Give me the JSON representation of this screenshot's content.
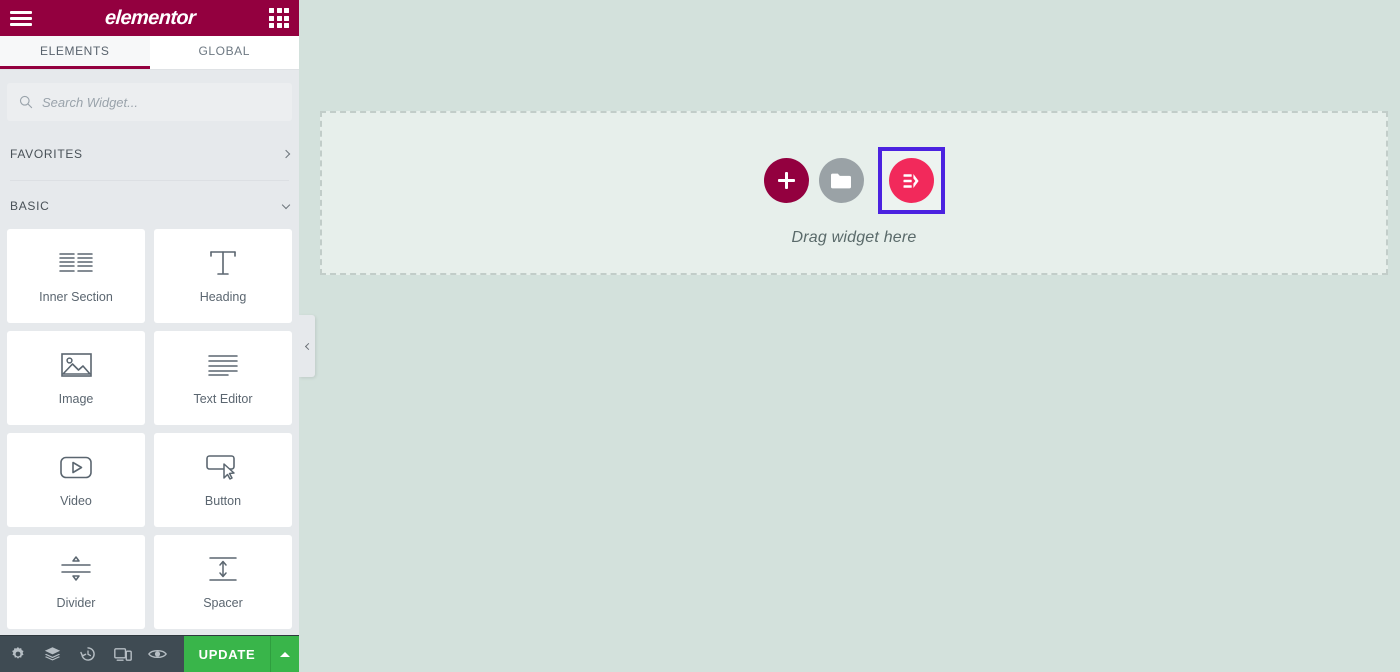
{
  "header": {
    "brand": "elementor",
    "menu_icon": "hamburger-icon",
    "apps_icon": "apps-grid-icon"
  },
  "tabs": [
    {
      "label": "ELEMENTS",
      "active": true
    },
    {
      "label": "GLOBAL",
      "active": false
    }
  ],
  "search": {
    "placeholder": "Search Widget...",
    "value": "",
    "icon": "search-icon"
  },
  "sections": [
    {
      "label": "FAVORITES",
      "state": "collapsed",
      "icon": "chevron-right-icon"
    },
    {
      "label": "BASIC",
      "state": "expanded",
      "icon": "chevron-down-icon"
    }
  ],
  "widgets": [
    {
      "label": "Inner Section",
      "icon": "inner-section-icon"
    },
    {
      "label": "Heading",
      "icon": "heading-icon"
    },
    {
      "label": "Image",
      "icon": "image-icon"
    },
    {
      "label": "Text Editor",
      "icon": "text-editor-icon"
    },
    {
      "label": "Video",
      "icon": "video-icon"
    },
    {
      "label": "Button",
      "icon": "button-icon"
    },
    {
      "label": "Divider",
      "icon": "divider-icon"
    },
    {
      "label": "Spacer",
      "icon": "spacer-icon"
    }
  ],
  "canvas": {
    "drop_label": "Drag widget here",
    "add_section_icon": "plus-icon",
    "template_icon": "folder-icon",
    "elementor_icon": "elementor-logo-icon",
    "collapse_icon": "chevron-left-icon"
  },
  "footer": {
    "icons": [
      {
        "name": "gear-icon"
      },
      {
        "name": "layers-icon"
      },
      {
        "name": "history-icon"
      },
      {
        "name": "responsive-icon"
      },
      {
        "name": "preview-eye-icon"
      }
    ],
    "update_label": "UPDATE",
    "update_caret_icon": "caret-up-icon"
  },
  "colors": {
    "brand": "#93003f",
    "accent_pink": "#f2295b",
    "selection": "#4b22e0",
    "update_green": "#39b54a",
    "canvas_bg": "#d3e1dc"
  }
}
